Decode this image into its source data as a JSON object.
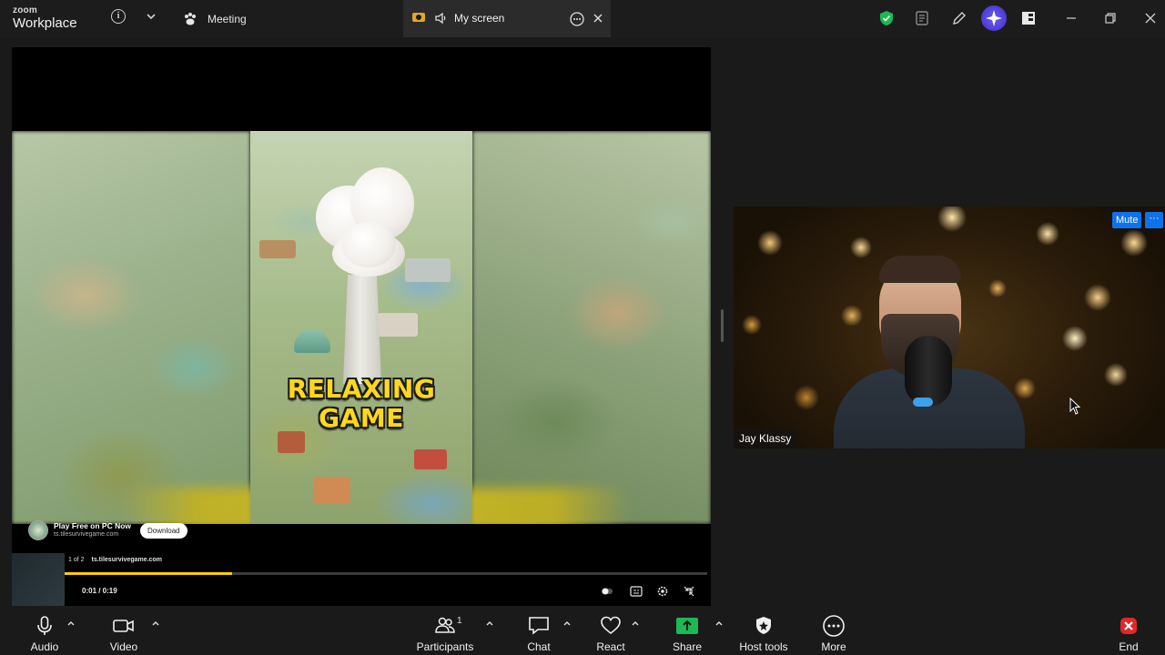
{
  "titlebar": {
    "brand_top": "zoom",
    "brand_bottom": "Workplace",
    "meeting_tab": "Meeting",
    "share_tab": "My screen",
    "info_icon": "info-icon",
    "colors": {
      "shield": "#1db954",
      "ai": "#5b4be6"
    }
  },
  "shared_content": {
    "video_title_line1": "RELAXING",
    "video_title_line2": "GAME",
    "ad": {
      "title": "Play Free on PC Now",
      "url": "ts.tilesurvivegame.com",
      "button": "Download"
    },
    "playlist": {
      "position": "1 of 2",
      "site": "ts.tilesurvivegame.com"
    },
    "time": "0:01 / 0:19",
    "progress": 0.26,
    "progress_color": "#ffcc00"
  },
  "participant": {
    "name": "Jay Klassy",
    "mute_label": "Mute",
    "more_label": "···"
  },
  "toolbar": {
    "audio": "Audio",
    "video": "Video",
    "participants": "Participants",
    "participant_count": "1",
    "chat": "Chat",
    "react": "React",
    "share": "Share",
    "host_tools": "Host tools",
    "more": "More",
    "end": "End",
    "colors": {
      "share": "#1db954",
      "end": "#e02828"
    }
  }
}
